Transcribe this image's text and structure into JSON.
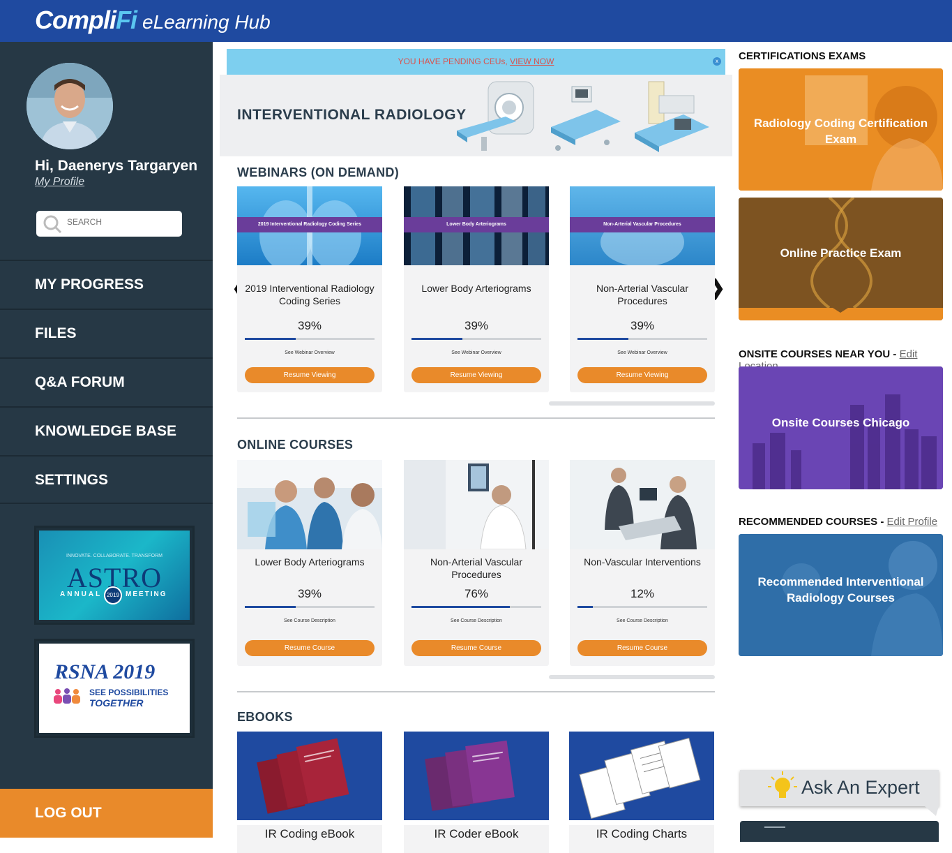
{
  "app": {
    "brand_main": "Compli",
    "brand_accent": "Fi",
    "brand_sub": "eLearning Hub"
  },
  "colors": {
    "header": "#1f4aa0",
    "sidebar": "#263845",
    "accent": "#e98a2a",
    "alert": "#7dcfef",
    "progress": "#1f4aa0"
  },
  "sidebar": {
    "greeting": "Hi, Daenerys Targaryen",
    "profile_link": "My Profile",
    "search_placeholder": "SEARCH",
    "nav": [
      {
        "label": "MY PROGRESS"
      },
      {
        "label": "FILES"
      },
      {
        "label": "Q&A FORUM"
      },
      {
        "label": "KNOWLEDGE BASE"
      },
      {
        "label": "SETTINGS"
      }
    ],
    "promo_astro": {
      "tagline": "INNOVATE. COLLABORATE. TRANSFORM",
      "name": "ASTRO",
      "left": "ANNUAL",
      "right": "MEETING",
      "year": "2019"
    },
    "promo_rsna": {
      "name": "RSNA",
      "year": "2019",
      "line1": "SEE POSSIBILITIES",
      "line2": "TOGETHER"
    },
    "logout": "LOG OUT"
  },
  "main": {
    "alert_text": "YOU HAVE PENDING CEUs, ",
    "alert_link": "VIEW NOW",
    "alert_close": "x",
    "hero_title": "INTERVENTIONAL RADIOLOGY",
    "webinars": {
      "title": "WEBINARS (ON DEMAND)",
      "items": [
        {
          "band": "2019 Interventional Radiology Coding Series",
          "name": "2019 Interventional Radiology Coding Series",
          "percent": "39%",
          "progress": 0.39,
          "link": "See Webinar Overview",
          "button": "Resume Viewing"
        },
        {
          "band": "Lower Body Arteriograms",
          "name": "Lower Body Arteriograms",
          "percent": "39%",
          "progress": 0.39,
          "link": "See Webinar Overview",
          "button": "Resume Viewing"
        },
        {
          "band": "Non-Arterial Vascular Procedures",
          "name": "Non-Arterial Vascular Procedures",
          "percent": "39%",
          "progress": 0.39,
          "link": "See Webinar Overview",
          "button": "Resume Viewing"
        }
      ]
    },
    "courses": {
      "title": "ONLINE COURSES",
      "items": [
        {
          "name": "Lower Body Arteriograms",
          "percent": "39%",
          "progress": 0.39,
          "link": "See Course Description",
          "button": "Resume Course"
        },
        {
          "name": "Non-Arterial Vascular Procedures",
          "percent": "76%",
          "progress": 0.76,
          "link": "See Course Description",
          "button": "Resume Course"
        },
        {
          "name": "Non-Vascular Interventions",
          "percent": "12%",
          "progress": 0.12,
          "link": "See Course Description",
          "button": "Resume Course"
        }
      ]
    },
    "ebooks": {
      "title": "EBOOKS",
      "items": [
        {
          "name": "IR Coding eBook"
        },
        {
          "name": "IR Coder eBook"
        },
        {
          "name": "IR Coding Charts"
        }
      ]
    },
    "arrow_left": "❮",
    "arrow_right": "❯"
  },
  "right": {
    "cert_title": "CERTIFICATIONS EXAMS",
    "cert_card_1": "Radiology Coding Certification Exam",
    "cert_card_2": "Online Practice Exam",
    "onsite_title": "ONSITE COURSES NEAR YOU",
    "onsite_sep": " - ",
    "onsite_link": "Edit Location",
    "onsite_card": "Onsite Courses Chicago",
    "rec_title": "RECOMMENDED COURSES",
    "rec_sep": " - ",
    "rec_link": "Edit Profile",
    "rec_card": "Recommended Interventional Radiology Courses",
    "expert_label": "Ask An Expert"
  }
}
